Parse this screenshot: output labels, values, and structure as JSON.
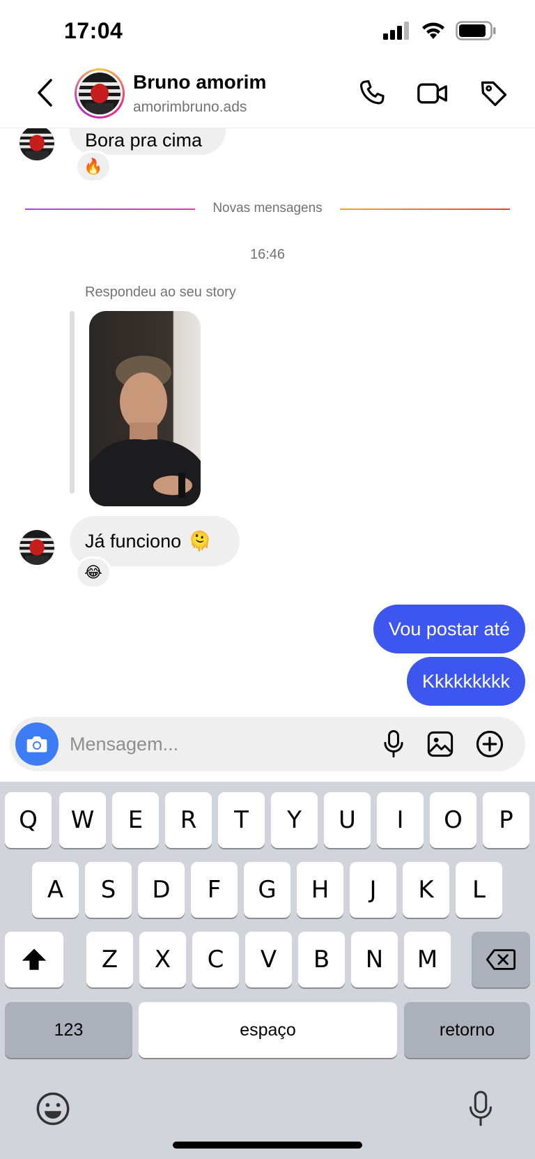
{
  "status_bar": {
    "time": "17:04"
  },
  "header": {
    "name": "Bruno amorim",
    "username": "amorimbruno.ads"
  },
  "chat": {
    "msg1": {
      "text": "Bora pra cima",
      "reaction": "🔥"
    },
    "divider_label": "Novas mensagens",
    "time_separator": "16:46",
    "story_reply_note": "Respondeu ao seu story",
    "msg2": {
      "text": "Já funciono",
      "emoji": "🫠",
      "reaction": "😂"
    },
    "outgoing": [
      {
        "text": "Vou postar até"
      },
      {
        "text": "Kkkkkkkkk"
      }
    ]
  },
  "composer": {
    "placeholder": "Mensagem..."
  },
  "keyboard": {
    "row1": [
      "Q",
      "W",
      "E",
      "R",
      "T",
      "Y",
      "U",
      "I",
      "O",
      "P"
    ],
    "row2": [
      "A",
      "S",
      "D",
      "F",
      "G",
      "H",
      "J",
      "K",
      "L"
    ],
    "row3": [
      "Z",
      "X",
      "C",
      "V",
      "B",
      "N",
      "M"
    ],
    "numbers_label": "123",
    "space_label": "espaço",
    "return_label": "retorno"
  },
  "colors": {
    "outgoing_bubble": "#3d56f0",
    "incoming_bubble": "#efefef",
    "camera_button": "#3d7cf5"
  },
  "icons": [
    "back-chevron-icon",
    "phone-icon",
    "video-camera-icon",
    "tag-icon",
    "camera-icon",
    "microphone-icon",
    "gallery-icon",
    "plus-circle-icon",
    "shift-icon",
    "backspace-icon",
    "emoji-icon",
    "dictation-mic-icon"
  ]
}
